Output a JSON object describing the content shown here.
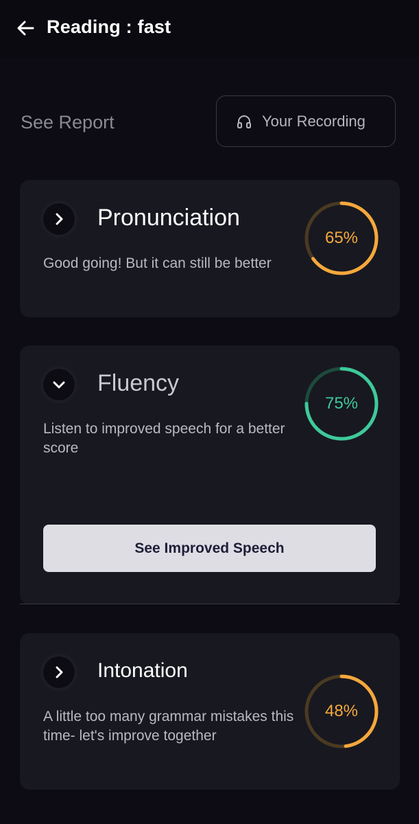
{
  "header": {
    "title": "Reading : fast",
    "back_icon": "arrow-left-icon"
  },
  "report": {
    "label": "See Report",
    "recording_button": "Your Recording",
    "recording_icon": "headphones-icon"
  },
  "cards": [
    {
      "title": "Pronunciation",
      "description": "Good going! But it can still be better",
      "percent_label": "65%",
      "score": 65,
      "color": "#f5a83c",
      "expanded": false
    },
    {
      "title": "Fluency",
      "description": "Listen to improved speech for a better score",
      "percent_label": "75%",
      "score": 75,
      "color": "#3ec99a",
      "expanded": true,
      "button_label": "See Improved Speech"
    },
    {
      "title": "Intonation",
      "description": "A little too many grammar mistakes this time- let's improve together",
      "percent_label": "48%",
      "score": 48,
      "color": "#f5a83c",
      "expanded": false
    }
  ]
}
